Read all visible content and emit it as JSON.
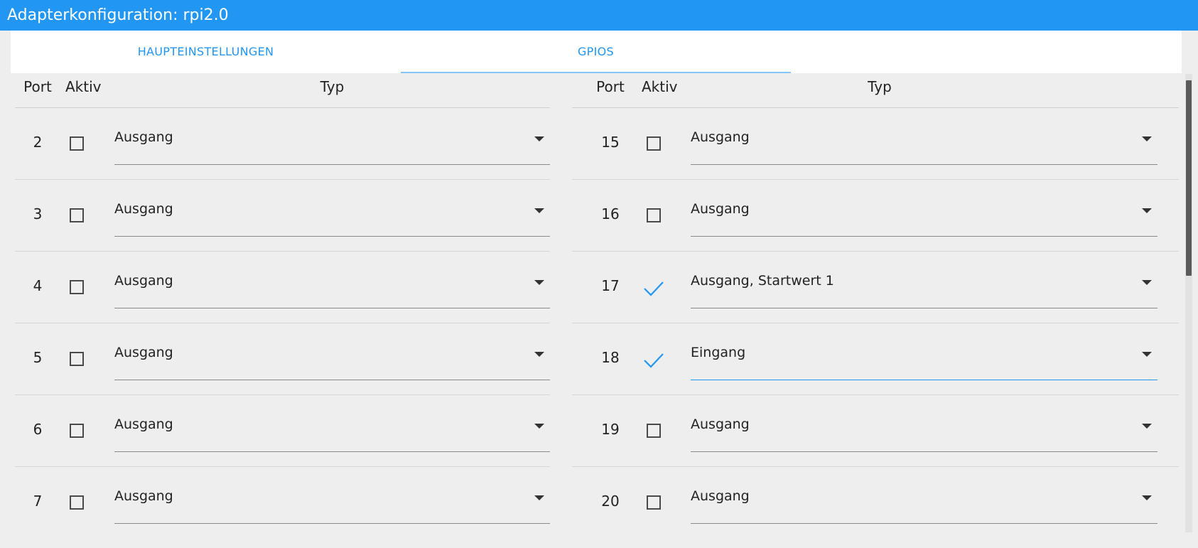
{
  "window": {
    "title": "Adapterkonfiguration: rpi2.0"
  },
  "tabs": [
    {
      "label": "HAUPTEINSTELLUNGEN",
      "active": false
    },
    {
      "label": "GPIOS",
      "active": true
    }
  ],
  "colors": {
    "accent": "#2196f3",
    "background": "#eeeeee"
  },
  "table_left": {
    "headers": {
      "port": "Port",
      "active": "Aktiv",
      "type": "Typ"
    },
    "rows": [
      {
        "port": "2",
        "active": false,
        "type": "Ausgang"
      },
      {
        "port": "3",
        "active": false,
        "type": "Ausgang"
      },
      {
        "port": "4",
        "active": false,
        "type": "Ausgang"
      },
      {
        "port": "5",
        "active": false,
        "type": "Ausgang"
      },
      {
        "port": "6",
        "active": false,
        "type": "Ausgang"
      },
      {
        "port": "7",
        "active": false,
        "type": "Ausgang"
      }
    ]
  },
  "table_right": {
    "headers": {
      "port": "Port",
      "active": "Aktiv",
      "type": "Typ"
    },
    "rows": [
      {
        "port": "15",
        "active": false,
        "type": "Ausgang"
      },
      {
        "port": "16",
        "active": false,
        "type": "Ausgang"
      },
      {
        "port": "17",
        "active": true,
        "type": "Ausgang, Startwert 1"
      },
      {
        "port": "18",
        "active": true,
        "type": "Eingang",
        "focused": true
      },
      {
        "port": "19",
        "active": false,
        "type": "Ausgang"
      },
      {
        "port": "20",
        "active": false,
        "type": "Ausgang"
      }
    ]
  },
  "icons": {
    "checked": "check-icon",
    "unchecked": "checkbox-unchecked-icon",
    "dropdown": "dropdown-arrow-icon"
  }
}
